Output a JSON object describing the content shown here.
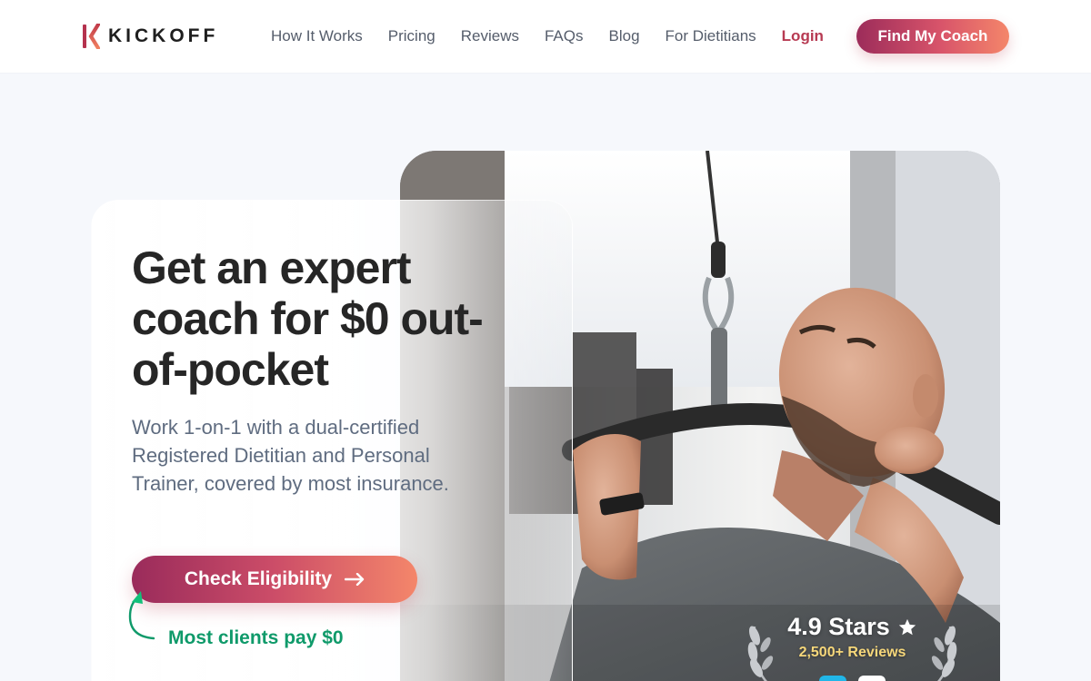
{
  "header": {
    "brand": "KICKOFF",
    "nav": [
      "How It Works",
      "Pricing",
      "Reviews",
      "FAQs",
      "Blog",
      "For Dietitians"
    ],
    "login": "Login",
    "cta": "Find My Coach"
  },
  "hero": {
    "headline": "Get an expert coach for $0 out-of-pocket",
    "subtext": "Work 1-on-1 with a dual-certified Registered Dietitian and Personal Trainer, covered by most insurance.",
    "cta": "Check Eligibility",
    "note": "Most clients pay $0"
  },
  "rating": {
    "stars_text": "4.9 Stars",
    "reviews_text": "2,500+ Reviews"
  },
  "icons": {
    "logo": "kickoff-logo-icon",
    "cta_arrow": "arrow-right-icon",
    "curve": "curved-arrow-icon",
    "star": "star-icon",
    "laurel": "laurel-icon"
  },
  "colors": {
    "brand_gradient_start": "#9c2c5a",
    "brand_gradient_end": "#f4866a",
    "note_green": "#0f9a6a",
    "login_red": "#b73a52",
    "rating_gold": "#f6d77a"
  }
}
